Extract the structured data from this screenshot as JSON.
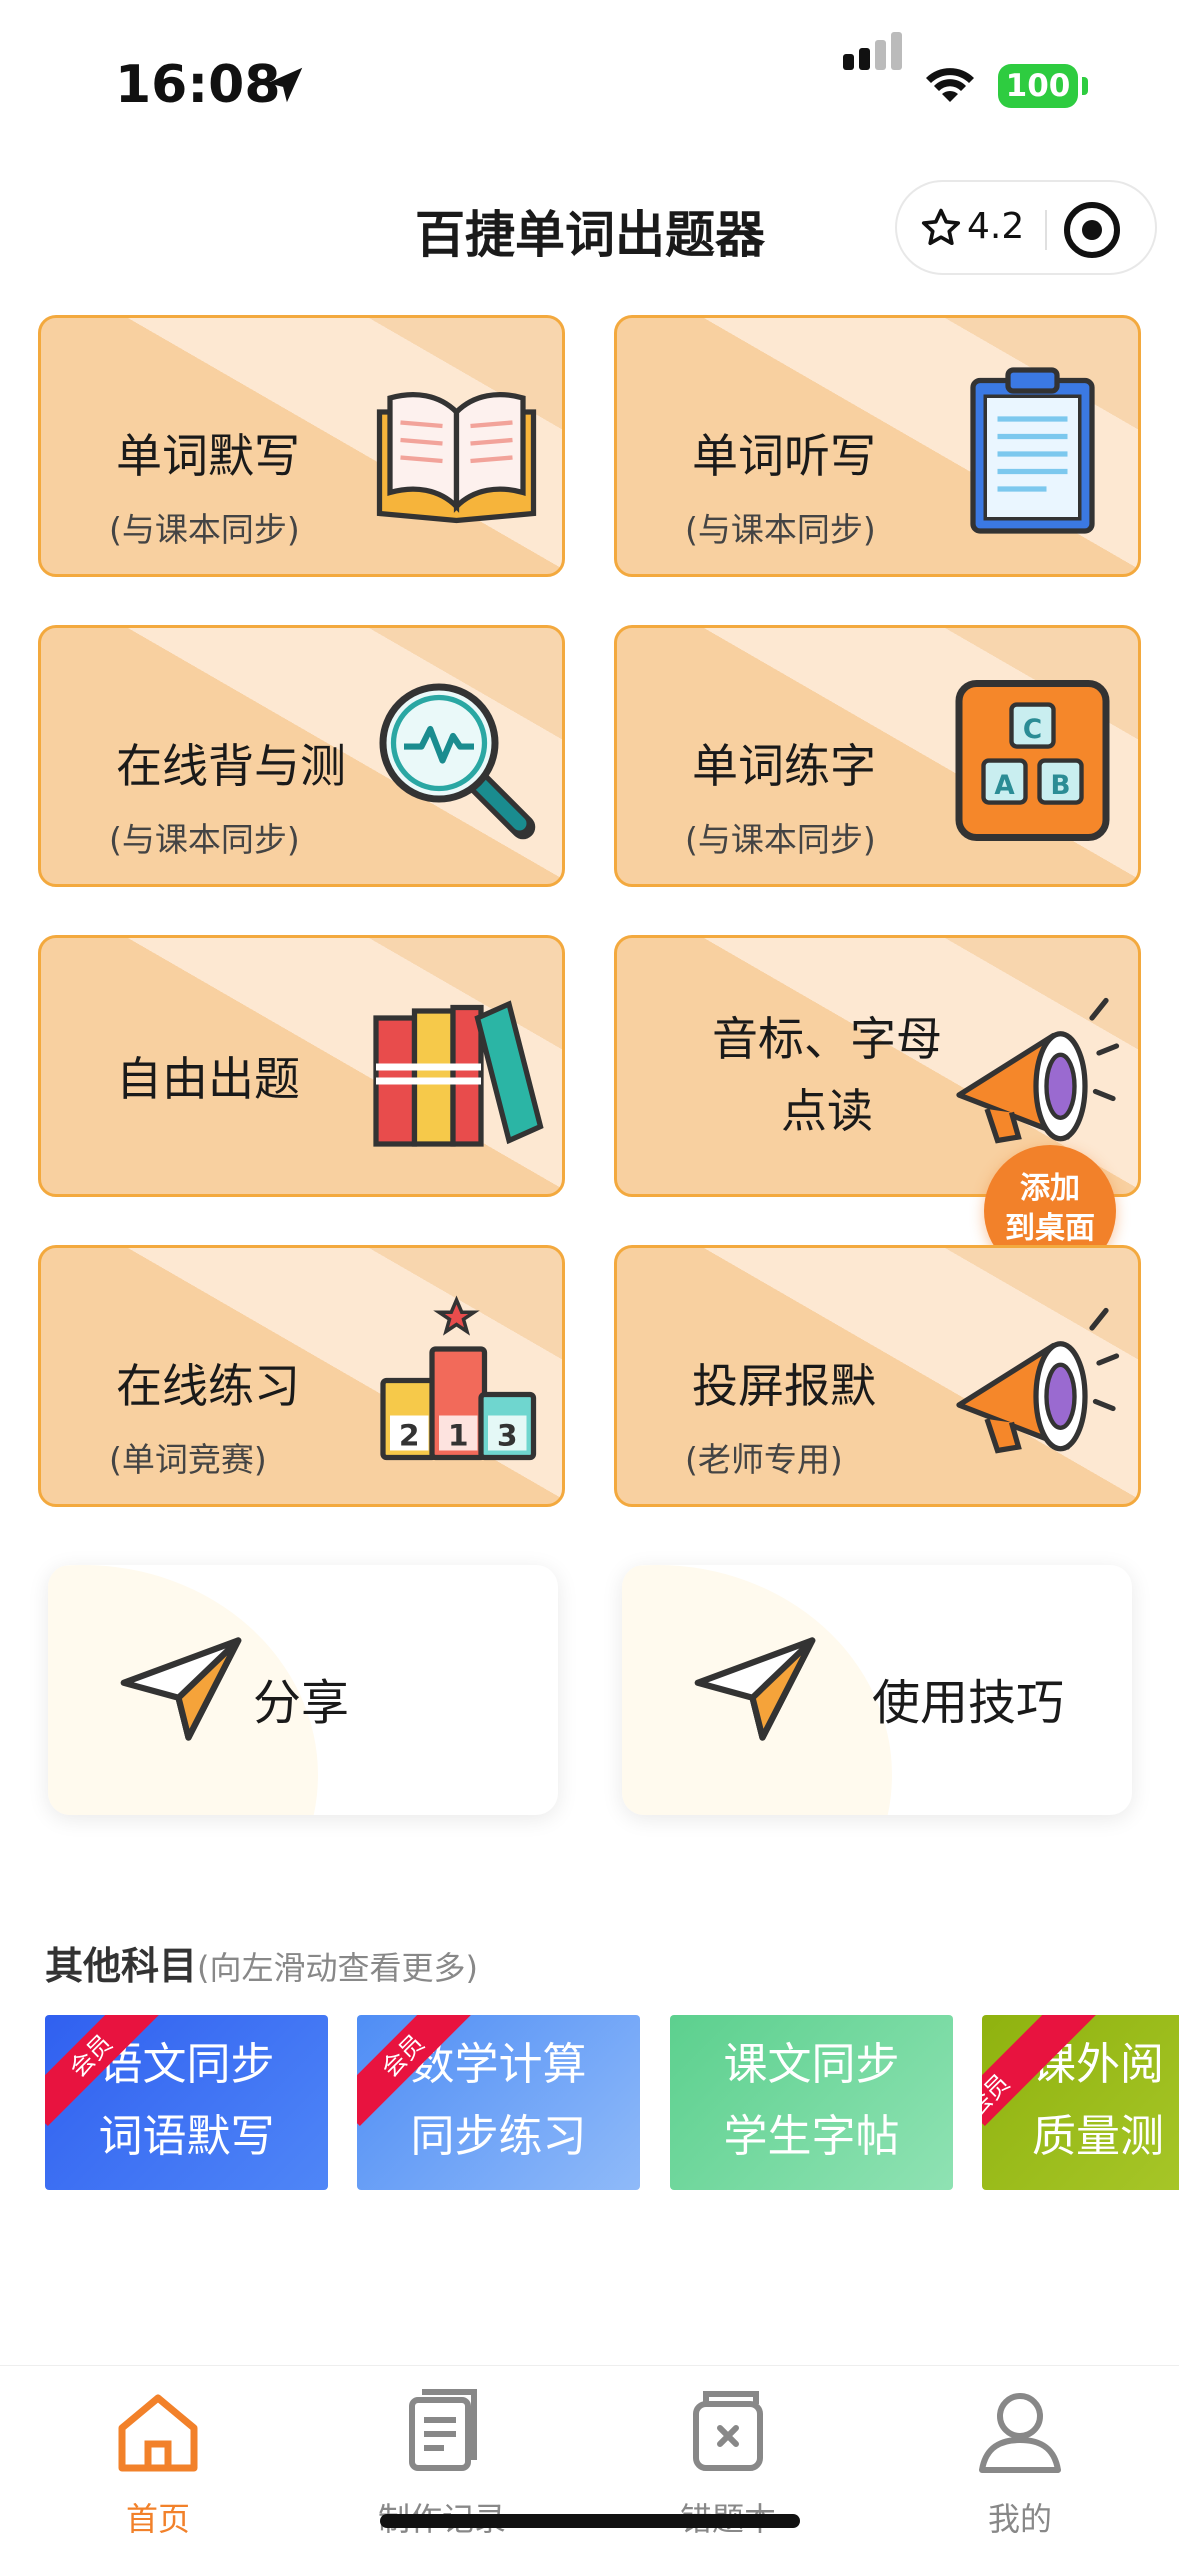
{
  "status_bar": {
    "time": "16:08",
    "battery": "100"
  },
  "header": {
    "title": "百捷单词出题器",
    "rating": "4.2"
  },
  "features": [
    {
      "title": "单词默写",
      "subtitle": "(与课本同步)",
      "icon": "open-book-icon"
    },
    {
      "title": "单词听写",
      "subtitle": "(与课本同步)",
      "icon": "clipboard-icon"
    },
    {
      "title": "在线背与测",
      "subtitle": "(与课本同步)",
      "icon": "magnifier-icon"
    },
    {
      "title": "单词练字",
      "subtitle": "(与课本同步)",
      "icon": "abc-blocks-icon"
    },
    {
      "title": "自由出题",
      "subtitle": "",
      "icon": "books-icon"
    },
    {
      "title": "音标、字母",
      "title2": "点读",
      "icon": "megaphone-icon"
    },
    {
      "title": "在线练习",
      "subtitle": "(单词竞赛)",
      "icon": "podium-icon"
    },
    {
      "title": "投屏报默",
      "subtitle": "(老师专用)",
      "icon": "megaphone-icon"
    }
  ],
  "badge": {
    "line1": "添加",
    "line2": "到桌面"
  },
  "tips": [
    {
      "label": "分享",
      "icon": "paper-plane-icon"
    },
    {
      "label": "使用技巧",
      "icon": "paper-plane-icon"
    }
  ],
  "other_subjects": {
    "title": "其他科目",
    "hint": "(向左滑动查看更多)",
    "items": [
      {
        "line1": "语文同步",
        "line2": "词语默写",
        "ribbon": "会员",
        "color": "#3a6ff2"
      },
      {
        "line1": "数学计算",
        "line2": "同步练习",
        "ribbon": "会员",
        "color": "#6aa3f7"
      },
      {
        "line1": "课文同步",
        "line2": "学生字帖",
        "ribbon": "",
        "color": "#6fd49a"
      },
      {
        "line1": "课外阅",
        "line2": "质量测",
        "ribbon": "会员",
        "color": "#9cba18"
      }
    ]
  },
  "tabbar": {
    "items": [
      {
        "label": "首页",
        "icon": "home-icon",
        "active": true
      },
      {
        "label": "制作记录",
        "icon": "document-icon",
        "active": false
      },
      {
        "label": "错题本",
        "icon": "error-book-icon",
        "active": false
      },
      {
        "label": "我的",
        "icon": "user-icon",
        "active": false
      }
    ]
  },
  "colors": {
    "accent": "#f2812a",
    "card_border": "#f3a93e",
    "card_fill": "#f8d0a0"
  }
}
